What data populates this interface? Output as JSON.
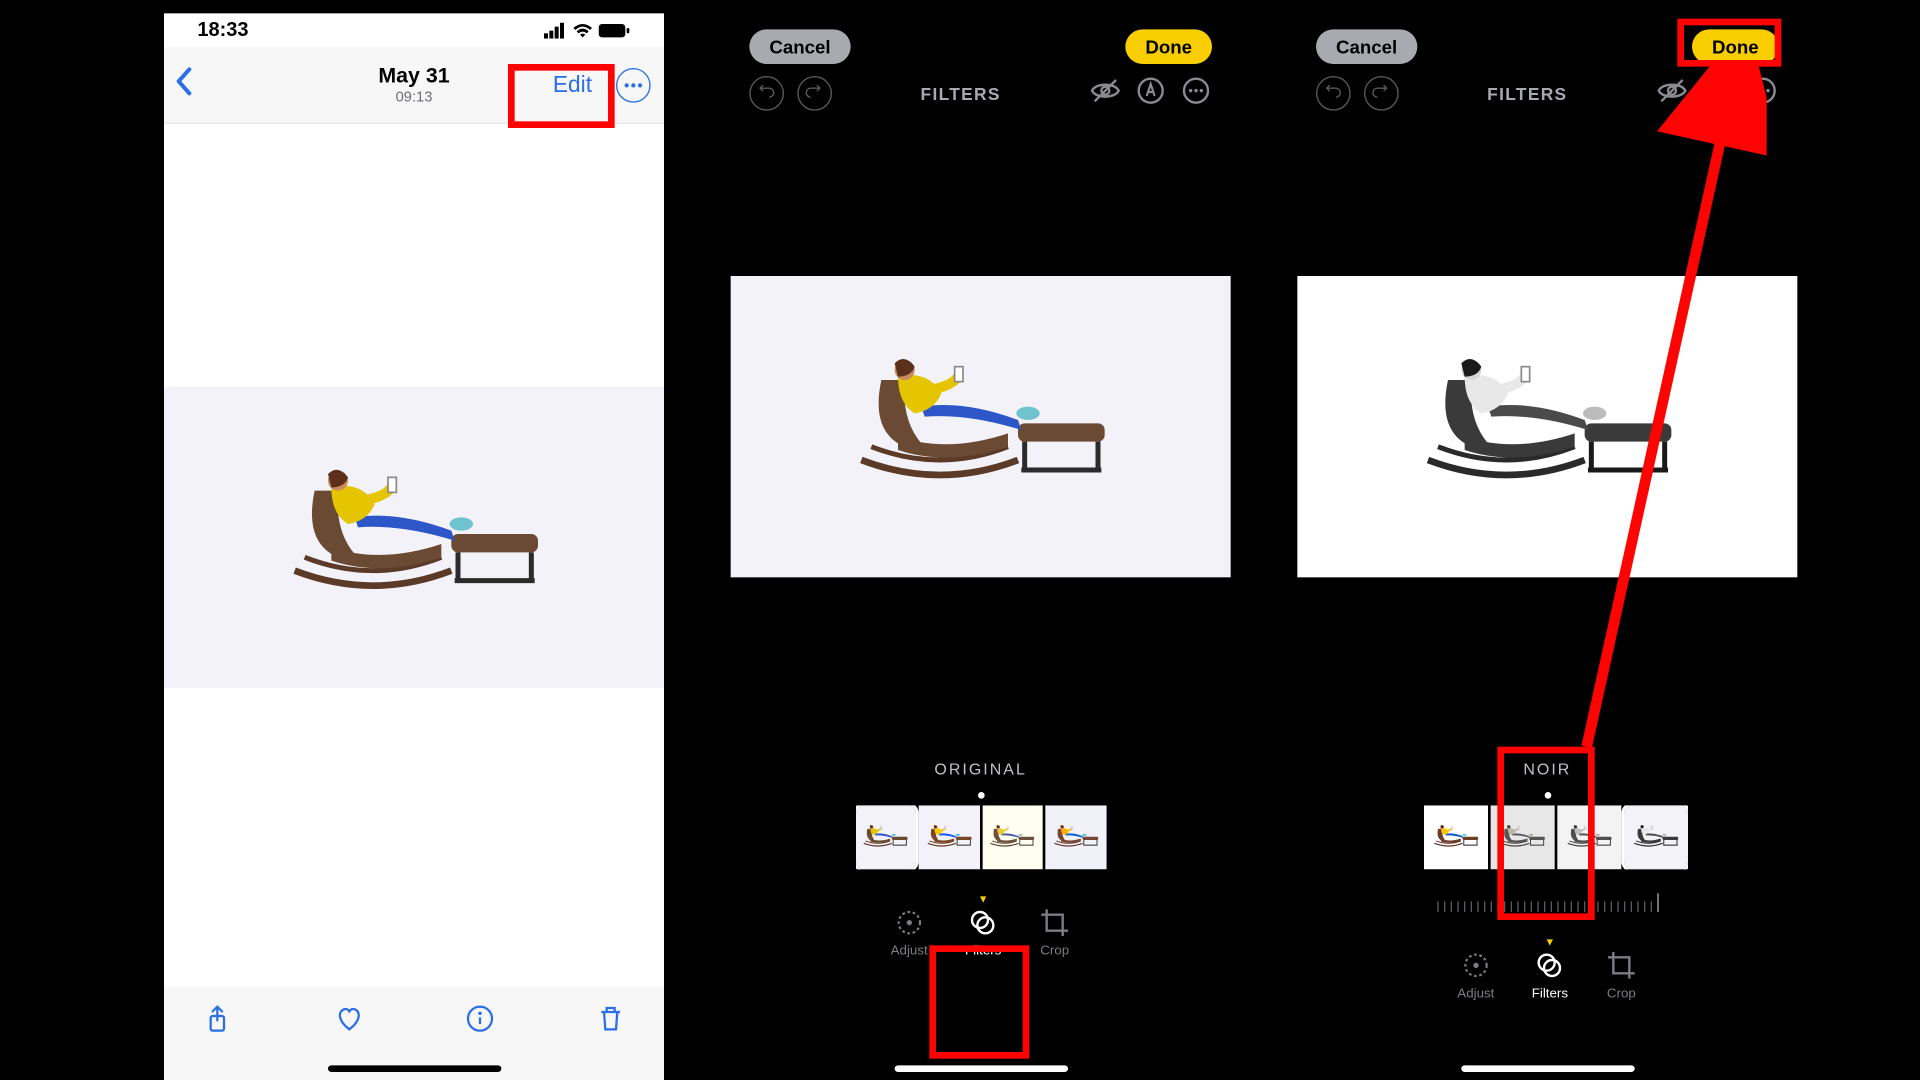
{
  "status": {
    "time": "18:33"
  },
  "viewer": {
    "date": "May 31",
    "subtime": "09:13",
    "edit": "Edit"
  },
  "editor2": {
    "cancel": "Cancel",
    "done": "Done",
    "header": "FILTERS",
    "filterName": "ORIGINAL",
    "tabs": {
      "adjust": "Adjust",
      "filters": "Filters",
      "crop": "Crop"
    }
  },
  "editor3": {
    "cancel": "Cancel",
    "done": "Done",
    "header": "FILTERS",
    "filterName": "NOIR",
    "tabs": {
      "adjust": "Adjust",
      "filters": "Filters",
      "crop": "Crop"
    }
  }
}
